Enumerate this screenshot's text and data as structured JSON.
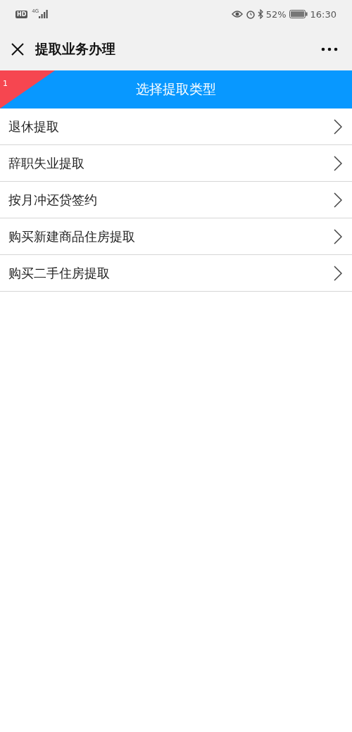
{
  "status_bar": {
    "hd": "HD",
    "network": "4G",
    "battery": "52%",
    "time": "16:30"
  },
  "header": {
    "title": "提取业务办理"
  },
  "banner": {
    "step": "1",
    "title": "选择提取类型"
  },
  "items": [
    {
      "label": "退休提取"
    },
    {
      "label": "辞职失业提取"
    },
    {
      "label": "按月冲还贷签约"
    },
    {
      "label": "购买新建商品住房提取"
    },
    {
      "label": "购买二手住房提取"
    }
  ]
}
